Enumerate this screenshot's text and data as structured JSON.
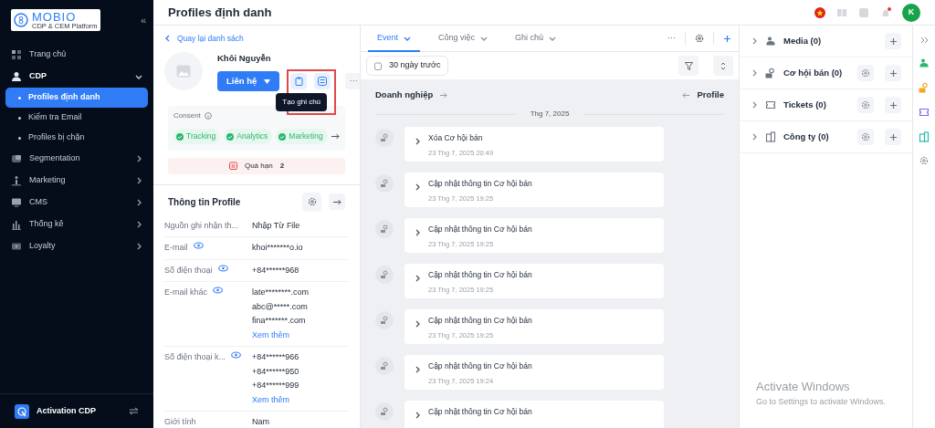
{
  "sidebar": {
    "logo": {
      "name": "MOBIO",
      "tagline": "CDP & CEM Platform"
    },
    "collapse": "«",
    "items": [
      {
        "label": "Trang chủ"
      },
      {
        "label": "CDP",
        "expanded": true,
        "children": [
          {
            "label": "Profiles định danh",
            "selected": true
          },
          {
            "label": "Kiểm tra Email",
            "selected": false
          },
          {
            "label": "Profiles bị chặn",
            "selected": false
          }
        ]
      },
      {
        "label": "Segmentation",
        "expanded": false
      },
      {
        "label": "Marketing",
        "expanded": false
      },
      {
        "label": "CMS",
        "expanded": false
      },
      {
        "label": "Thống kê",
        "expanded": false
      },
      {
        "label": "Loyalty",
        "expanded": false
      }
    ],
    "footer": {
      "label": "Activation CDP"
    }
  },
  "header": {
    "title": "Profiles định danh",
    "avatar": "K",
    "notification": true
  },
  "profile": {
    "back": "Quay lại danh sách",
    "name": "Khôi Nguyễn",
    "contact_button": "Liên hệ",
    "highlighted": true,
    "tooltip": "Tạo ghi chú",
    "more": "···",
    "consent": {
      "label": "Consent",
      "tags": [
        "Tracking",
        "Analytics",
        "Marketing"
      ]
    },
    "overdue": {
      "label": "Quá hạn",
      "count": "2"
    },
    "info_title": "Thông tin Profile",
    "fields": [
      {
        "label": "Nguồn ghi nhận th...",
        "masked": false,
        "values": [
          "Nhập Từ File"
        ]
      },
      {
        "label": "E-mail",
        "masked": true,
        "values": [
          "khoi*******o.io"
        ]
      },
      {
        "label": "Số điện thoại",
        "masked": true,
        "values": [
          "+84******968"
        ]
      },
      {
        "label": "E-mail khác",
        "masked": true,
        "values": [
          "late********.com",
          "abc@*****.com",
          "fina*******.com"
        ],
        "more": "Xem thêm"
      },
      {
        "label": "Số điện thoại k...",
        "masked": true,
        "values": [
          "+84******966",
          "+84******950",
          "+84******999"
        ],
        "more": "Xem thêm"
      },
      {
        "label": "Giới tính",
        "masked": false,
        "values": [
          "Nam"
        ]
      }
    ]
  },
  "timeline": {
    "tabs": [
      {
        "label": "Event",
        "selected": true
      },
      {
        "label": "Công việc",
        "selected": false
      },
      {
        "label": "Ghi chú",
        "selected": false
      }
    ],
    "more": "···",
    "date_filter": "30 ngày trước",
    "left_label": "Doanh nghiệp",
    "right_label": "Profile",
    "date_group": "Thg 7, 2025",
    "events": [
      {
        "title": "Xóa Cơ hội bán",
        "time": "23 Thg 7, 2025 20:49"
      },
      {
        "title": "Cập nhật thông tin Cơ hội bán",
        "time": "23 Thg 7, 2025 19:25"
      },
      {
        "title": "Cập nhật thông tin Cơ hội bán",
        "time": "23 Thg 7, 2025 19:25"
      },
      {
        "title": "Cập nhật thông tin Cơ hội bán",
        "time": "23 Thg 7, 2025 19:25"
      },
      {
        "title": "Cập nhật thông tin Cơ hội bán",
        "time": "23 Thg 7, 2025 19:25"
      },
      {
        "title": "Cập nhật thông tin Cơ hội bán",
        "time": "23 Thg 7, 2025 19:24"
      },
      {
        "title": "Cập nhật thông tin Cơ hội bán"
      }
    ]
  },
  "related": [
    {
      "label": "Media (0)",
      "settings": false,
      "color": "#2bb673"
    },
    {
      "label": "Cơ hội bán (0)",
      "settings": true,
      "color": "#f5a623"
    },
    {
      "label": "Tickets (0)",
      "settings": true,
      "color": "#8b5cf6"
    },
    {
      "label": "Công ty (0)",
      "settings": true,
      "color": "#14b8a6"
    }
  ],
  "os_notice": {
    "title": "Activate Windows",
    "text": "Go to Settings to activate Windows."
  }
}
